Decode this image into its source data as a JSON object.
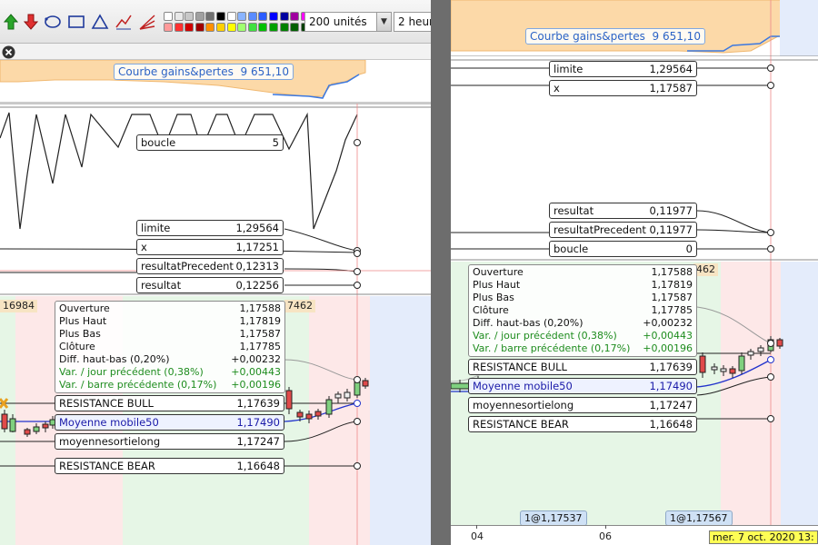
{
  "toolbar": {
    "icons": [
      "buy-arrow-icon",
      "sell-arrow-icon",
      "lasso-icon",
      "rectangle-icon",
      "triangle-icon",
      "trendline-icon",
      "fan-icon"
    ],
    "colors_row1": [
      "#ffffff",
      "#e8e8e8",
      "#c8c8c8",
      "#a0a0a0",
      "#707070",
      "#000000",
      "#ffffff",
      "#8ab4ff",
      "#5a8cff",
      "#2a5cff",
      "#0000ff",
      "#0000a0",
      "#a000a0",
      "#ff00ff"
    ],
    "colors_row2": [
      "#ff9a9a",
      "#ff3030",
      "#d00000",
      "#a00000",
      "#ff9000",
      "#ffd000",
      "#ffff00",
      "#a0ff70",
      "#40e040",
      "#00c000",
      "#00a000",
      "#008000",
      "#006000",
      "#004000"
    ],
    "units_select": "200 unités",
    "period_select": "2 heur"
  },
  "left": {
    "pl_label": "Courbe gains&pertes",
    "pl_value": "9 651,10",
    "indicators_top": [
      {
        "name": "boucle",
        "value": "5"
      },
      {
        "name": "limite",
        "value": "1,29564"
      },
      {
        "name": "x",
        "value": "1,17251"
      },
      {
        "name": "resultatPrecedent",
        "value": "0,12313"
      },
      {
        "name": "resultat",
        "value": "0,12256"
      }
    ],
    "tags": [
      "16984",
      "7462"
    ],
    "ohlc": [
      {
        "label": "Ouverture",
        "value": "1,17588",
        "green": false
      },
      {
        "label": "Plus Haut",
        "value": "1,17819",
        "green": false
      },
      {
        "label": "Plus Bas",
        "value": "1,17587",
        "green": false
      },
      {
        "label": "Clôture",
        "value": "1,17785",
        "green": false
      },
      {
        "label": "Diff. haut-bas (0,20%)",
        "value": "+0,00232",
        "green": false
      },
      {
        "label": "Var. / jour précédent (0,38%)",
        "value": "+0,00443",
        "green": true
      },
      {
        "label": "Var. / barre précédente (0,17%)",
        "value": "+0,00196",
        "green": true
      }
    ],
    "levels": [
      {
        "name": "RESISTANCE BULL",
        "value": "1,17639"
      },
      {
        "name": "Moyenne mobile50",
        "value": "1,17490"
      },
      {
        "name": "moyennesortielong",
        "value": "1,17247"
      },
      {
        "name": "RESISTANCE BEAR",
        "value": "1,16648"
      }
    ]
  },
  "right": {
    "pl_label": "Courbe gains&pertes",
    "pl_value": "9 651,10",
    "indicators_a": [
      {
        "name": "limite",
        "value": "1,29564"
      },
      {
        "name": "x",
        "value": "1,17587"
      }
    ],
    "indicators_b": [
      {
        "name": "resultat",
        "value": "0,11977"
      },
      {
        "name": "resultatPrecedent",
        "value": "0,11977"
      },
      {
        "name": "boucle",
        "value": "0"
      }
    ],
    "tag": "462",
    "ohlc": [
      {
        "label": "Ouverture",
        "value": "1,17588",
        "green": false
      },
      {
        "label": "Plus Haut",
        "value": "1,17819",
        "green": false
      },
      {
        "label": "Plus Bas",
        "value": "1,17587",
        "green": false
      },
      {
        "label": "Clôture",
        "value": "1,17785",
        "green": false
      },
      {
        "label": "Diff. haut-bas (0,20%)",
        "value": "+0,00232",
        "green": false
      },
      {
        "label": "Var. / jour précédent (0,38%)",
        "value": "+0,00443",
        "green": true
      },
      {
        "label": "Var. / barre précédente (0,17%)",
        "value": "+0,00196",
        "green": true
      }
    ],
    "levels": [
      {
        "name": "RESISTANCE BULL",
        "value": "1,17639"
      },
      {
        "name": "Moyenne mobile50",
        "value": "1,17490"
      },
      {
        "name": "moyennesortielong",
        "value": "1,17247"
      },
      {
        "name": "RESISTANCE BEAR",
        "value": "1,16648"
      }
    ],
    "xaxis_ticks": [
      "04",
      "06"
    ],
    "trade_markers": [
      "1@1,17537",
      "1@1,17567"
    ],
    "date_label": "mer. 7 oct. 2020 13:"
  }
}
